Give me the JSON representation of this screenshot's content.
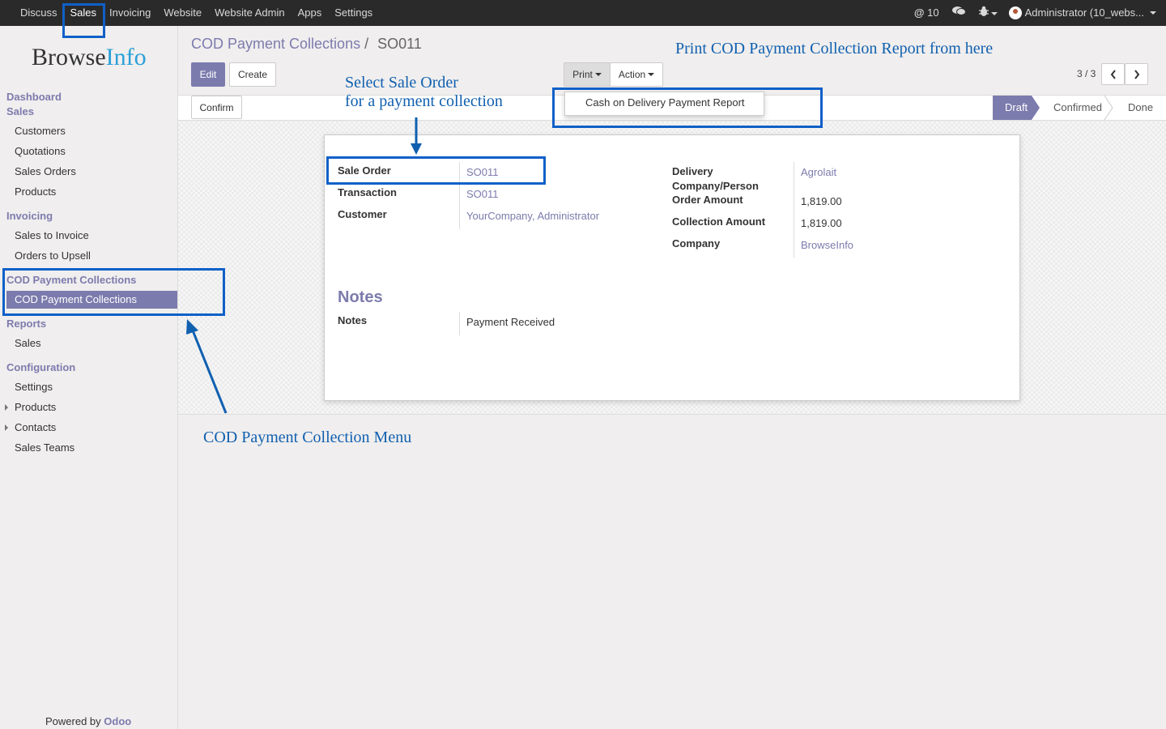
{
  "topbar": {
    "menu": [
      "Discuss",
      "Sales",
      "Invoicing",
      "Website",
      "Website Admin",
      "Apps",
      "Settings"
    ],
    "active": "Sales",
    "mentions_count": "10",
    "user": "Administrator (10_webs..."
  },
  "sidebar": {
    "logo_browse": "Browse",
    "logo_info": "Info",
    "heads": {
      "dashboard": "Dashboard",
      "sales": "Sales",
      "invoicing": "Invoicing",
      "cod": "COD Payment Collections",
      "reports": "Reports",
      "configuration": "Configuration"
    },
    "items": {
      "customers": "Customers",
      "quotations": "Quotations",
      "sales_orders": "Sales Orders",
      "products": "Products",
      "sales_to_invoice": "Sales to Invoice",
      "orders_to_upsell": "Orders to Upsell",
      "cod_collections": "COD Payment Collections",
      "reports_sales": "Sales",
      "settings": "Settings",
      "config_products": "Products",
      "contacts": "Contacts",
      "sales_teams": "Sales Teams"
    },
    "powered_by": "Powered by",
    "powered_brand": "Odoo"
  },
  "breadcrumb": {
    "parent": "COD Payment Collections",
    "separator": "/",
    "current": "SO011"
  },
  "buttons": {
    "edit": "Edit",
    "create": "Create",
    "print": "Print",
    "action": "Action",
    "confirm": "Confirm"
  },
  "pager": "3 / 3",
  "print_menu": [
    "Cash on Delivery Payment Report"
  ],
  "statusbar": {
    "stages": [
      "Draft",
      "Confirmed",
      "Done"
    ],
    "active": "Draft"
  },
  "form": {
    "left": [
      {
        "label": "Sale Order",
        "value": "SO011"
      },
      {
        "label": "Transaction",
        "value": "SO011"
      },
      {
        "label": "Customer",
        "value": "YourCompany, Administrator"
      }
    ],
    "right": [
      {
        "label": "Delivery Company/Person",
        "value": "Agrolait"
      },
      {
        "label": "Order Amount",
        "value": "1,819.00"
      },
      {
        "label": "Collection Amount",
        "value": "1,819.00"
      },
      {
        "label": "Company",
        "value": "BrowseInfo"
      }
    ],
    "notes_title": "Notes",
    "notes_label": "Notes",
    "notes_value": "Payment Received"
  },
  "annotations": {
    "print_report": "Print COD Payment Collection Report from here",
    "select_sale_order_1": "Select Sale Order",
    "select_sale_order_2": "for a payment collection",
    "cod_menu": "COD Payment Collection Menu"
  },
  "colors": {
    "accent": "#7c7bad",
    "annotation": "#1060c8",
    "topbar": "#2a2a2a"
  }
}
